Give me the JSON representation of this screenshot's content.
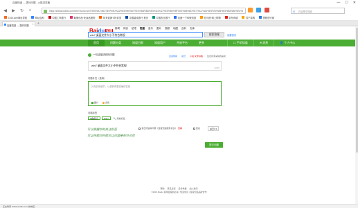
{
  "browser": {
    "window_title": "百度知道 — 提问问题 - 火狐浏览器",
    "controls": [
      "—",
      "☐",
      "✕"
    ],
    "url": "https://zhidao.baidu.com/new?word=win7%E6%A1%8C%E9%9D%A2%E6%96%87%E4%BB%B6%E5%A4%A7%E5%B0%8F%E4%B8%8D%E7%AC%A6%E5%90%88%E5%B8%B8%E5%85%AC&ie=GBK&entry=common_header",
    "search_placeholder": "在谷歌中搜索",
    "search_engine_glyph": "G",
    "bookmarks": [
      {
        "label": "2345.com网址导航",
        "color": "#f06b1f"
      },
      {
        "label": "网址百科",
        "color": "#3385ff"
      },
      {
        "label": "中国工商银行",
        "color": "#c7000b"
      },
      {
        "label": "聚美优品·化妆品团购",
        "color": "#e1336f"
      },
      {
        "label": "年末促销·5折封顶",
        "color": "#ff6600"
      },
      {
        "label": "中国建设银行·首页",
        "color": "#0a4da2"
      },
      {
        "label": "中国农业银行",
        "color": "#00957a"
      },
      {
        "label": "百度一下你就知道",
        "color": "#2a6df4"
      },
      {
        "label": "亚马逊·网上购物",
        "color": "#ff9900"
      },
      {
        "label": "京东商城",
        "color": "#e1251b"
      },
      {
        "label": "苏宁易购",
        "color": "#f7a600"
      },
      {
        "label": "携程旅行网",
        "color": "#2a7de1"
      }
    ],
    "tab": {
      "label": "百度知道 — 提问问题",
      "close": "×"
    },
    "newtab": "+"
  },
  "zhidao": {
    "logo_a": "Bai",
    "logo_b": "du",
    "logo_zd": "知道",
    "topnav": [
      "新闻",
      "网页",
      "贴吧",
      "知道",
      "音乐",
      "图片",
      "视频",
      "地图",
      "百科",
      "文库"
    ],
    "active_topnav": "知道",
    "search_value": "win7 桌面文件大小不符合常规",
    "search_button": "搜索答案",
    "right_links": "我要提问",
    "green_nav": [
      "首页",
      "问题分类",
      "知道日报",
      "知道用户",
      "开放平台",
      "更多"
    ],
    "green_nav_right": [
      "☐ 手机知道",
      "✉ 消息",
      "👤 个人中心"
    ],
    "crumb_title": "一句话描述你的问题",
    "crumb_sub": "",
    "meta": [
      "百度帮助",
      "悬赏",
      "小说·文学书籍",
      "您还有未采纳的提问"
    ],
    "question_value": "win7 桌面文件大小不符合常规",
    "question_counter": "20/50",
    "desc_label": "问题补充（选填）",
    "desc_placeholder": "补充具体细节，以便获得更准确的答案",
    "tools": [
      "图片",
      "表情"
    ],
    "tag_label": "问题标签",
    "tags": [
      "电脑知识",
      "Win7"
    ],
    "tag_add": "添加标签",
    "note_line1": "可以根据你的关注标签",
    "note_line2": "可以在提问时提示让问题更有针对性",
    "agree_text": "我已阅读并同意《百度知道服务协议》",
    "agree_link": "查看",
    "anon_label": "匿名",
    "reward_label": "悬赏0 ▾",
    "submit_label": "提交问题",
    "footer_links": [
      "帮助",
      "意见反馈",
      "投诉举报",
      "加入我们"
    ],
    "footer_copy": "©2016 Baidu 使用百度前必读 | 知道协议 | 百度知道品牌合作"
  },
  "statusbar": "正在等待 zhidao.baidu.com 的响应..."
}
